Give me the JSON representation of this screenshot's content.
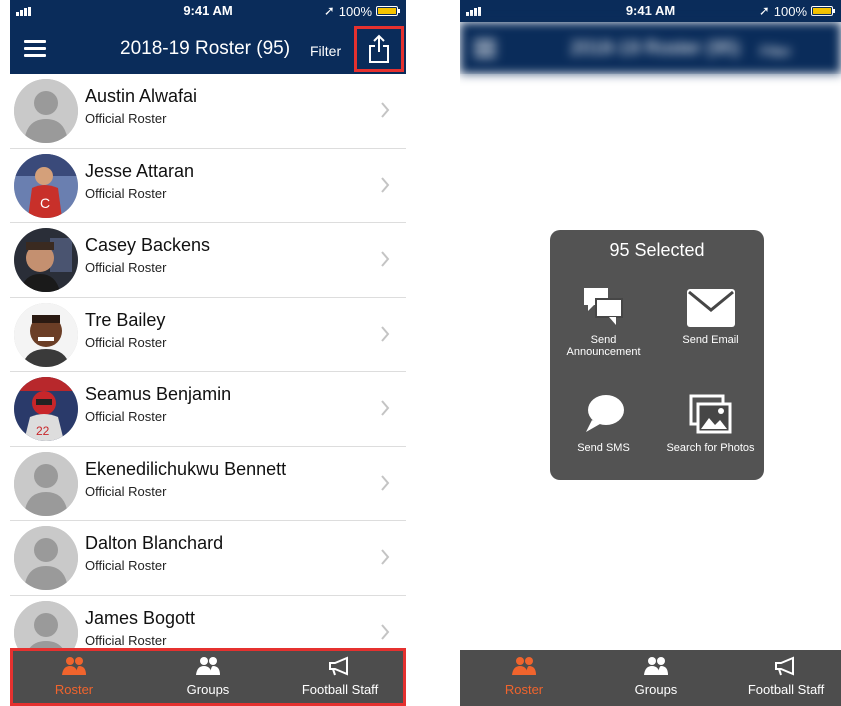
{
  "status": {
    "time": "9:41 AM",
    "battery": "100%"
  },
  "header": {
    "title": "2018-19 Roster (95)",
    "filter_label": "Filter"
  },
  "roster": [
    {
      "name": "Austin Alwafai",
      "subtitle": "Official Roster",
      "avatar": "placeholder"
    },
    {
      "name": "Jesse Attaran",
      "subtitle": "Official Roster",
      "avatar": "photo"
    },
    {
      "name": "Casey Backens",
      "subtitle": "Official Roster",
      "avatar": "photo"
    },
    {
      "name": "Tre Bailey",
      "subtitle": "Official Roster",
      "avatar": "photo"
    },
    {
      "name": "Seamus Benjamin",
      "subtitle": "Official Roster",
      "avatar": "photo"
    },
    {
      "name": "Ekenedilichukwu Bennett",
      "subtitle": "Official Roster",
      "avatar": "placeholder"
    },
    {
      "name": "Dalton Blanchard",
      "subtitle": "Official Roster",
      "avatar": "placeholder"
    },
    {
      "name": "James Bogott",
      "subtitle": "Official Roster",
      "avatar": "placeholder"
    }
  ],
  "tabs": [
    {
      "label": "Roster",
      "icon": "people-icon",
      "active": true
    },
    {
      "label": "Groups",
      "icon": "groups-icon",
      "active": false
    },
    {
      "label": "Football Staff",
      "icon": "megaphone-icon",
      "active": false
    }
  ],
  "popup": {
    "title": "95 Selected",
    "actions": [
      {
        "label_line1": "Send",
        "label_line2": "Announcement",
        "icon": "chat-bubbles-icon"
      },
      {
        "label": "Send Email",
        "icon": "envelope-icon"
      },
      {
        "label": "Send SMS",
        "icon": "speech-bubble-icon"
      },
      {
        "label": "Search for Photos",
        "icon": "photos-icon"
      }
    ]
  },
  "colors": {
    "navy": "#0a2c5a",
    "accent": "#f0642d",
    "highlight": "#e5312f",
    "tabbar": "#4d4d4d"
  }
}
